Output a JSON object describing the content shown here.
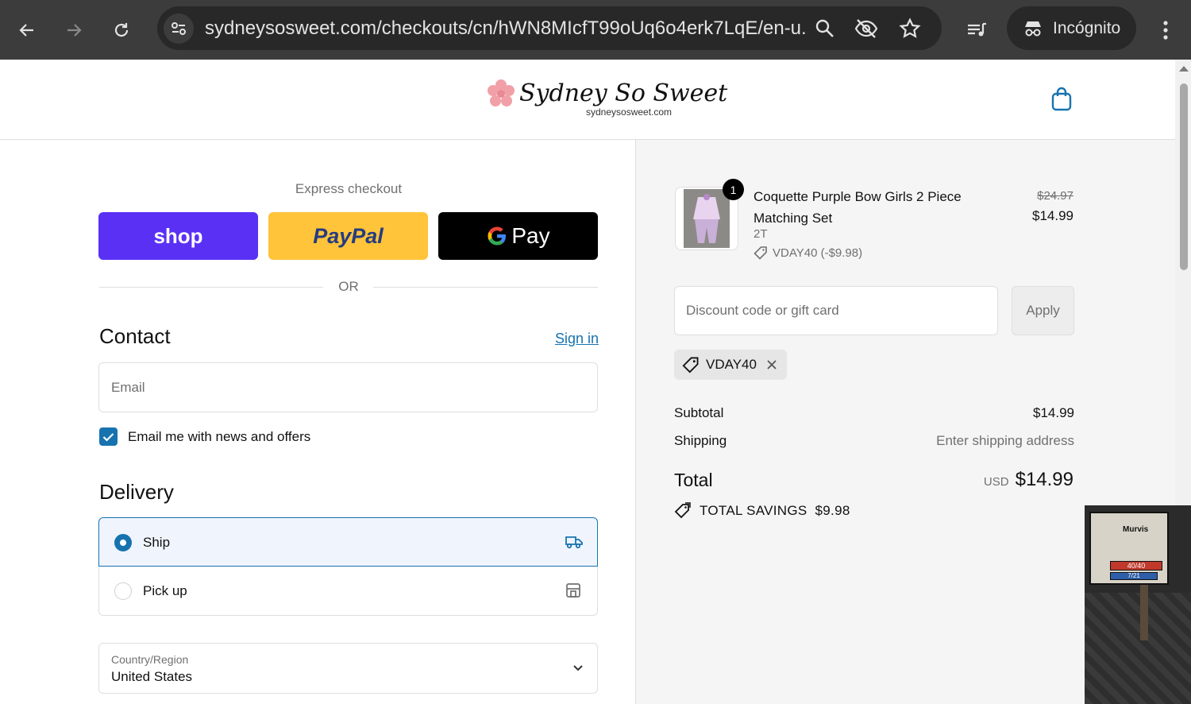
{
  "browser": {
    "url": "sydneysosweet.com/checkouts/cn/hWN8MIcfT99oUq6o4erk7LqE/en-u...",
    "incognito_label": "Incógnito"
  },
  "store": {
    "logo_text": "Sydney So Sweet",
    "logo_subtext": "sydneysosweet.com"
  },
  "express": {
    "label": "Express checkout",
    "shop_label": "shop",
    "paypal_label": "PayPal",
    "gpay_label": "Pay",
    "or_label": "OR"
  },
  "contact": {
    "title": "Contact",
    "sign_in": "Sign in",
    "email_placeholder": "Email",
    "news_label": "Email me with news and offers",
    "news_checked": true
  },
  "delivery": {
    "title": "Delivery",
    "options": [
      {
        "label": "Ship",
        "selected": true
      },
      {
        "label": "Pick up",
        "selected": false
      }
    ],
    "country_label": "Country/Region",
    "country_value": "United States"
  },
  "order": {
    "item": {
      "name": "Coquette Purple Bow Girls 2 Piece Matching Set",
      "variant": "2T",
      "discount": "VDAY40 (-$9.98)",
      "quantity": "1",
      "price_original": "$24.97",
      "price_final": "$14.99"
    },
    "discount_placeholder": "Discount code or gift card",
    "apply_label": "Apply",
    "applied_code": "VDAY40",
    "subtotal_label": "Subtotal",
    "subtotal_value": "$14.99",
    "shipping_label": "Shipping",
    "shipping_value": "Enter shipping address",
    "total_label": "Total",
    "total_currency": "USD",
    "total_value": "$14.99",
    "savings_label": "TOTAL SAVINGS",
    "savings_value": "$9.98"
  },
  "overlay": {
    "name": "Murvis",
    "hp": "40/40",
    "mp": "7/21"
  },
  "colors": {
    "accent": "#1773b0",
    "shop_purple": "#5a31f4",
    "paypal_yellow": "#ffc439"
  }
}
